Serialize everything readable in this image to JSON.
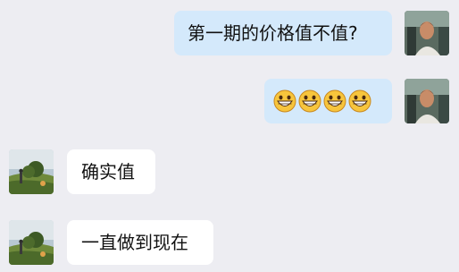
{
  "messages": [
    {
      "side": "right",
      "type": "text",
      "text": "第一期的价格值不值?"
    },
    {
      "side": "right",
      "type": "emoji",
      "emoji": [
        "grinning-face-emoji",
        "grinning-face-emoji",
        "grinning-face-emoji",
        "grinning-face-emoji"
      ]
    },
    {
      "side": "left",
      "type": "text",
      "text": "确实值"
    },
    {
      "side": "left",
      "type": "text",
      "text": "一直做到现在"
    }
  ],
  "colors": {
    "background": "#ededf2",
    "right_bubble": "#d4e9fb",
    "left_bubble": "#ffffff"
  }
}
